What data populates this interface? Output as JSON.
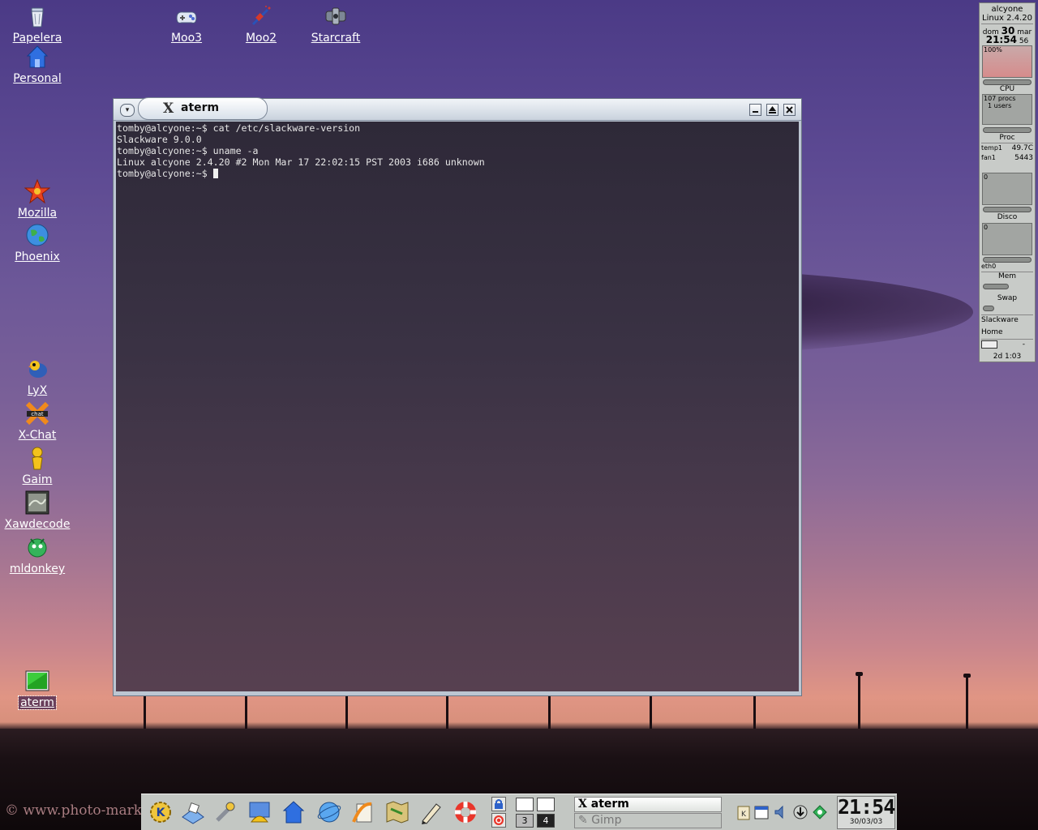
{
  "desktop": {
    "icons": [
      {
        "label": "Papelera"
      },
      {
        "label": "Personal"
      },
      {
        "label": "Moo3"
      },
      {
        "label": "Moo2"
      },
      {
        "label": "Starcraft"
      },
      {
        "label": "Mozilla"
      },
      {
        "label": "Phoenix"
      },
      {
        "label": "LyX"
      },
      {
        "label": "X-Chat"
      },
      {
        "label": "Gaim"
      },
      {
        "label": "Xawdecode"
      },
      {
        "label": "mldonkey"
      },
      {
        "label": "aterm"
      }
    ],
    "watermark": "© www.photo-mark"
  },
  "terminal": {
    "title": "aterm",
    "lines": [
      "tomby@alcyone:~$ cat /etc/slackware-version",
      "Slackware 9.0.0",
      "tomby@alcyone:~$ uname -a",
      "Linux alcyone 2.4.20 #2 Mon Mar 17 22:02:15 PST 2003 i686 unknown",
      "tomby@alcyone:~$ "
    ]
  },
  "gkrellm": {
    "host": "alcyone",
    "kernel": "Linux 2.4.20",
    "day": "dom",
    "date_num": "30",
    "month": "mar",
    "time": "21:54",
    "seconds": "56",
    "cpu_percent": "100%",
    "cpu_label": "CPU",
    "procs": "107 procs",
    "users": "1 users",
    "proc_label": "Proc",
    "temp_label": "temp1",
    "temp_value": "49.7C",
    "fan_label": "fan1",
    "fan_value": "5443",
    "disk_zero": "0",
    "disk_label": "Disco",
    "net_zero": "0",
    "net_label": "eth0",
    "mem_label": "Mem",
    "swap_label": "Swap",
    "fs1": "Slackware",
    "fs2": "Home",
    "mail_value": "-",
    "uptime": "2d 1:03"
  },
  "taskbar": {
    "pager": [
      "1",
      "2",
      "3",
      "4"
    ],
    "tasks": [
      {
        "label": "aterm",
        "active": true
      },
      {
        "label": "Gimp",
        "active": false
      }
    ],
    "clock_time": "21:54",
    "clock_date": "30/03/03"
  }
}
